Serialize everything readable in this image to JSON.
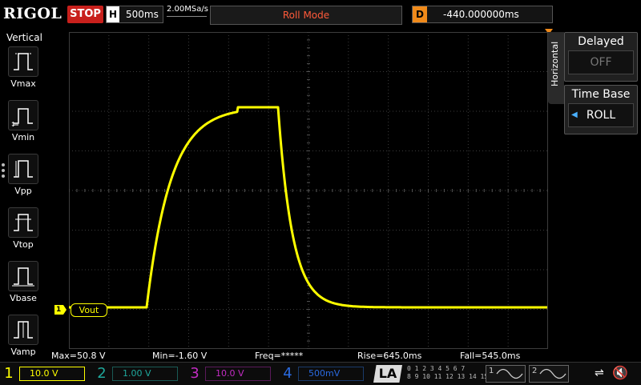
{
  "header": {
    "brand": "RIGOL",
    "run_state": "STOP",
    "timebase_tag": "H",
    "timebase_value": "500ms",
    "sample_rate": "2.00MSa/s",
    "mode": "Roll Mode",
    "delay_tag": "D",
    "delay_value": "-440.000000ms"
  },
  "left_panel": {
    "title": "Vertical",
    "items": [
      {
        "label": "Vmax",
        "icon": "vmax-icon"
      },
      {
        "label": "Vmin",
        "icon": "vmin-icon"
      },
      {
        "label": "Vpp",
        "icon": "vpp-icon"
      },
      {
        "label": "Vtop",
        "icon": "vtop-icon"
      },
      {
        "label": "Vbase",
        "icon": "vbase-icon"
      },
      {
        "label": "Vamp",
        "icon": "vamp-icon"
      }
    ]
  },
  "right_panel": {
    "section_label": "Horizontal",
    "delayed_title": "Delayed",
    "delayed_value": "OFF",
    "timebase_title": "Time Base",
    "timebase_value": "ROLL"
  },
  "trace": {
    "channel_marker": "1",
    "label": "Vout",
    "color": "#ffff00"
  },
  "measurements": {
    "max": "Max=50.8 V",
    "min": "Min=-1.60 V",
    "freq": "Freq=*****",
    "rise": "Rise=645.0ms",
    "fall": "Fall=545.0ms"
  },
  "channels": [
    {
      "num": "1",
      "scale": "10.0 V",
      "color": "#ffff00"
    },
    {
      "num": "2",
      "scale": "1.00 V",
      "color": "#1fa89c"
    },
    {
      "num": "3",
      "scale": "10.0 V",
      "color": "#c22cc2"
    },
    {
      "num": "4",
      "scale": "500mV",
      "color": "#2a6ae0"
    }
  ],
  "logic": {
    "label": "LA",
    "row1": "0 1 2 3  4 5 6 7",
    "row2": "8 9 10 11  12 13 14 15"
  },
  "generators": [
    {
      "num": "1"
    },
    {
      "num": "2"
    }
  ],
  "colors": {
    "grid": "#3c3c3c",
    "trace": "#ffff00",
    "stop": "#c8201c",
    "delay": "#f08a1a"
  }
}
